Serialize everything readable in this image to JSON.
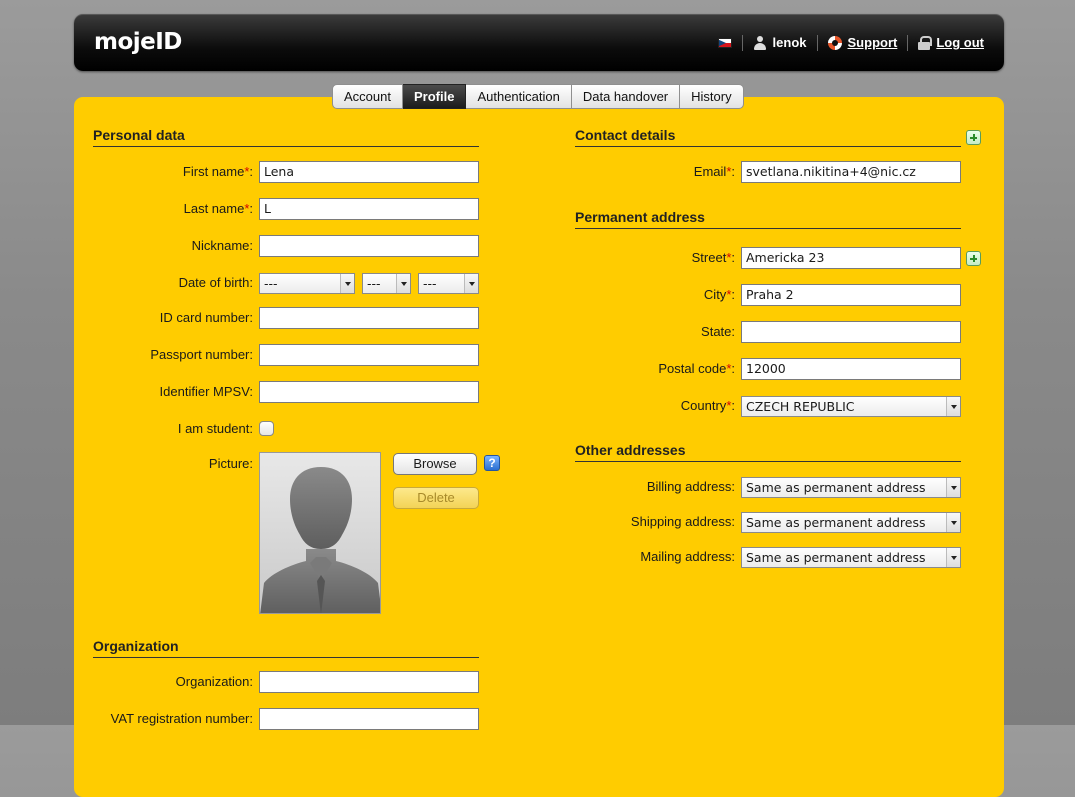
{
  "header": {
    "logo": "mojeID",
    "language_flag": "czech-flag",
    "username": "lenok",
    "support_label": "Support",
    "logout_label": "Log out"
  },
  "tabs": [
    {
      "label": "Account",
      "active": false
    },
    {
      "label": "Profile",
      "active": true
    },
    {
      "label": "Authentication",
      "active": false
    },
    {
      "label": "Data handover",
      "active": false
    },
    {
      "label": "History",
      "active": false
    }
  ],
  "personal": {
    "title": "Personal data",
    "first_name_label": "First name",
    "first_name_value": "Lena",
    "last_name_label": "Last name",
    "last_name_value": "L",
    "nickname_label": "Nickname:",
    "nickname_value": "",
    "dob_label": "Date of birth:",
    "dob_day": "---",
    "dob_month": "---",
    "dob_year": "---",
    "id_card_label": "ID card number:",
    "id_card_value": "",
    "passport_label": "Passport number:",
    "passport_value": "",
    "mpsv_label": "Identifier MPSV:",
    "mpsv_value": "",
    "student_label": "I am student:",
    "picture_label": "Picture:",
    "browse_label": "Browse",
    "help_label": "?",
    "delete_label": "Delete"
  },
  "organization": {
    "title": "Organization",
    "org_label": "Organization:",
    "org_value": "",
    "vat_label": "VAT registration number:",
    "vat_value": ""
  },
  "contact": {
    "title": "Contact details",
    "email_label": "Email",
    "email_value": "svetlana.nikitina+4@nic.cz"
  },
  "address": {
    "title": "Permanent address",
    "street_label": "Street",
    "street_value": "Americka 23",
    "city_label": "City",
    "city_value": "Praha 2",
    "state_label": "State:",
    "state_value": "",
    "postal_label": "Postal code",
    "postal_value": "12000",
    "country_label": "Country",
    "country_value": "CZECH REPUBLIC"
  },
  "other": {
    "title": "Other addresses",
    "billing_label": "Billing address:",
    "billing_value": "Same as permanent address",
    "shipping_label": "Shipping address:",
    "shipping_value": "Same as permanent address",
    "mailing_label": "Mailing address:",
    "mailing_value": "Same as permanent address"
  },
  "colors": {
    "panel": "#ffcc00",
    "required": "#d40000"
  }
}
